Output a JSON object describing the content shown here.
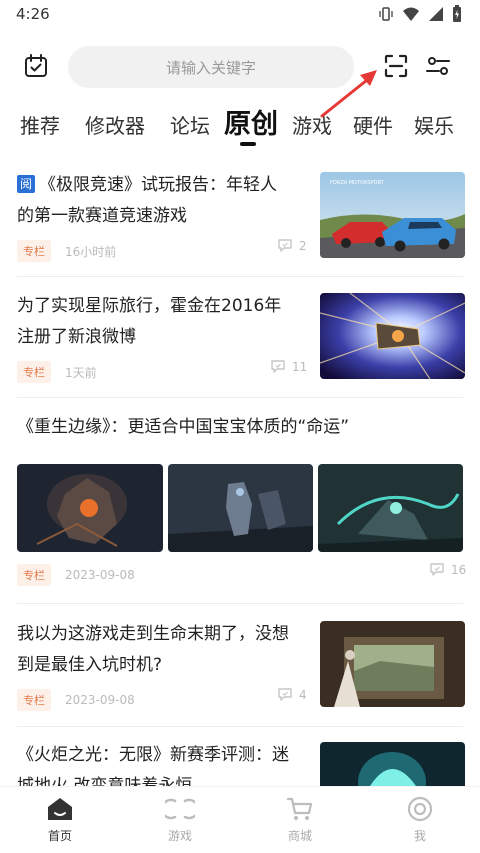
{
  "status": {
    "time": "4:26"
  },
  "search": {
    "placeholder": "请输入关键字"
  },
  "tabs": [
    "推荐",
    "修改器",
    "论坛",
    "原创",
    "游戏",
    "硬件",
    "娱乐"
  ],
  "articles": [
    {
      "badge": "阅",
      "title_line1": "《极限竞速》试玩报告：年轻人",
      "title_line2": "的第一款赛道竞速游戏",
      "tag": "专栏",
      "time": "16小时前",
      "comments": "2"
    },
    {
      "title_line1": "为了实现星际旅行，霍金在2016年",
      "title_line2": "注册了新浪微博",
      "tag": "专栏",
      "time": "1天前",
      "comments": "11"
    },
    {
      "title_line1": "《重生边缘》：更适合中国宝宝体质的“命运”",
      "tag": "专栏",
      "time": "2023-09-08",
      "comments": "16"
    },
    {
      "title_line1": "我以为这游戏走到生命末期了，没想",
      "title_line2": "到是最佳入坑时机?",
      "tag": "专栏",
      "time": "2023-09-08",
      "comments": "4"
    },
    {
      "title_line1": "《火炬之光：无限》新赛季评测：迷",
      "title_line2": "城地火 改变意味着永恒"
    }
  ],
  "thumb_text": {
    "forza": "FORZA MOTORSPORT"
  },
  "nav": [
    {
      "label": "首页",
      "icon": "home-icon"
    },
    {
      "label": "游戏",
      "icon": "game-icon"
    },
    {
      "label": "商城",
      "icon": "cart-icon"
    },
    {
      "label": "我",
      "icon": "profile-icon"
    }
  ],
  "colors": {
    "accent": "#e07a4a",
    "arrow": "#e53935",
    "badge": "#2a6fd6"
  }
}
